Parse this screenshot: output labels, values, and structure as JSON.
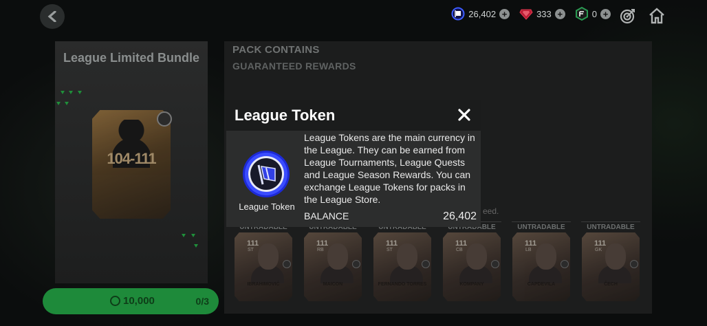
{
  "topbar": {
    "league_tokens": "26,402",
    "gems": "333",
    "fc_points": "0",
    "colors": {
      "token": "#3d5cff",
      "gem": "#d4213a",
      "points": "#2a9a52"
    }
  },
  "bundle": {
    "title": "League Limited Bundle",
    "card_rating": "104-111",
    "price": "10,000",
    "count": "0/3"
  },
  "contents": {
    "title": "PACK CONTAINS",
    "subtitle": "GUARANTEED REWARDS",
    "note_fragment": "eed.",
    "cards": [
      {
        "label": "UNTRADABLE",
        "rating": "111",
        "pos": "ST",
        "name": "IBRAHIMOVIĆ"
      },
      {
        "label": "UNTRADABLE",
        "rating": "111",
        "pos": "RB",
        "name": "MAICON"
      },
      {
        "label": "UNTRADABLE",
        "rating": "111",
        "pos": "ST",
        "name": "FERNANDO TORRES"
      },
      {
        "label": "UNTRADABLE",
        "rating": "111",
        "pos": "CB",
        "name": "KOMPANY"
      },
      {
        "label": "UNTRADABLE",
        "rating": "111",
        "pos": "LB",
        "name": "CAPDEVILA"
      },
      {
        "label": "UNTRADABLE",
        "rating": "111",
        "pos": "GK",
        "name": "ČECH"
      }
    ]
  },
  "modal": {
    "title": "League Token",
    "token_label": "League Token",
    "description": "League Tokens are the main currency in the League. They can be earned from League Tournaments, League Quests and League Season Rewards. You can exchange League Tokens for packs in the League Store.",
    "balance_label": "BALANCE",
    "balance_value": "26,402"
  }
}
